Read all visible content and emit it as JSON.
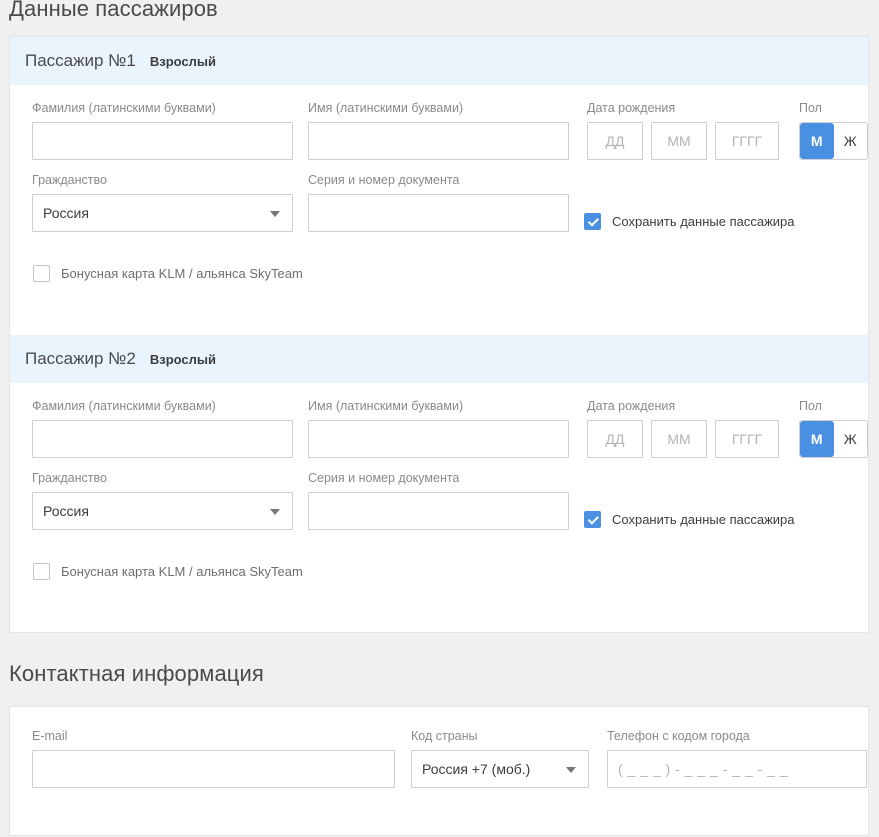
{
  "sections": {
    "passengers_title": "Данные пассажиров",
    "contacts_title": "Контактная информация"
  },
  "labels": {
    "surname": "Фамилия (латинскими буквами)",
    "name": "Имя (латинскими буквами)",
    "birth_date": "Дата рождения",
    "gender": "Пол",
    "citizenship": "Гражданство",
    "document": "Серия и номер документа",
    "email": "E-mail",
    "country_code": "Код страны",
    "phone": "Телефон с кодом города"
  },
  "placeholders": {
    "day": "ДД",
    "month": "ММ",
    "year": "ГГГГ",
    "empty": "",
    "phone_mask": "( _ _ _ ) - _ _ _ - _ _ - _ _"
  },
  "gender_options": {
    "male": "М",
    "female": "Ж"
  },
  "checkbox_labels": {
    "save_passenger": "Сохранить данные пассажира",
    "bonus_card": "Бонусная карта KLM / альянса SkyTeam"
  },
  "passengers": [
    {
      "title": "Пассажир №1",
      "type": "Взрослый",
      "surname_value": "",
      "name_value": "",
      "day_value": "",
      "month_value": "",
      "year_value": "",
      "gender_selected": "М",
      "citizenship_value": "Россия",
      "document_value": "",
      "save_checked": true,
      "bonus_checked": false
    },
    {
      "title": "Пассажир №2",
      "type": "Взрослый",
      "surname_value": "",
      "name_value": "",
      "day_value": "",
      "month_value": "",
      "year_value": "",
      "gender_selected": "М",
      "citizenship_value": "Россия",
      "document_value": "",
      "save_checked": true,
      "bonus_checked": false
    }
  ],
  "contacts": {
    "email_value": "",
    "country_code_value": "Россия +7 (моб.)",
    "phone_value": ""
  },
  "colors": {
    "accent": "#4a90e2",
    "band": "#eaf4fd",
    "page_bg": "#f0f0f0",
    "card_bg": "#ffffff",
    "border": "#cfcfcf",
    "label": "#8a8a8a"
  }
}
